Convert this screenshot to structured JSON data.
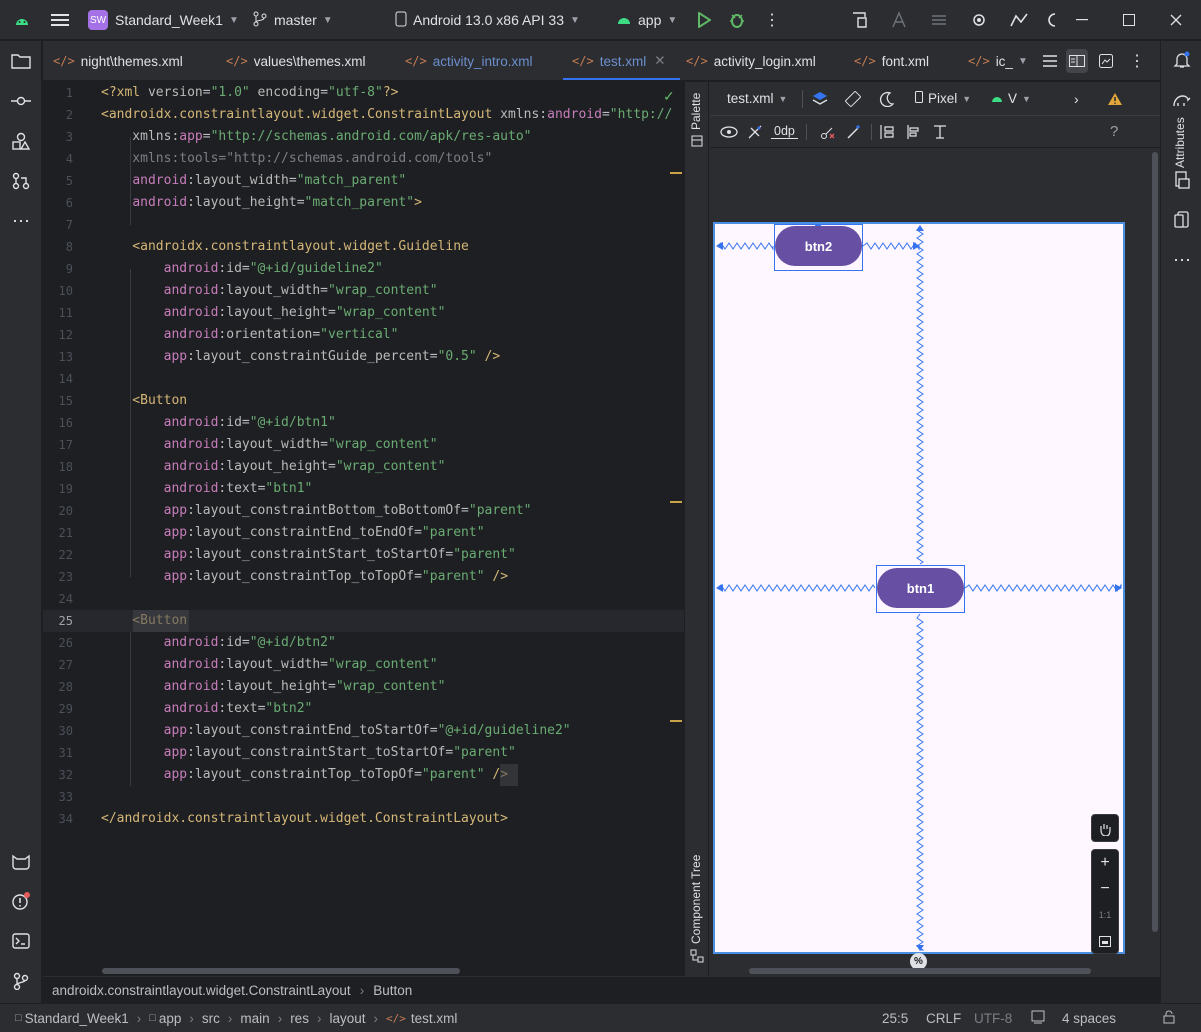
{
  "titlebar": {
    "project_badge": "SW",
    "project": "Standard_Week1",
    "branch": "master",
    "device": "Android 13.0 x86 API 33",
    "run_config": "app"
  },
  "tabs": [
    {
      "label": "night\\themes.xml",
      "active": false
    },
    {
      "label": "values\\themes.xml",
      "active": false
    },
    {
      "label": "activity_intro.xml",
      "active": false
    },
    {
      "label": "test.xml",
      "active": true
    },
    {
      "label": "activity_login.xml",
      "active": false
    },
    {
      "label": "font.xml",
      "active": false
    },
    {
      "label": "ic_",
      "active": false
    }
  ],
  "editor": {
    "line_numbers": [
      "1",
      "2",
      "3",
      "4",
      "5",
      "6",
      "7",
      "8",
      "9",
      "10",
      "11",
      "12",
      "13",
      "14",
      "15",
      "16",
      "17",
      "18",
      "19",
      "20",
      "21",
      "22",
      "23",
      "24",
      "25",
      "26",
      "27",
      "28",
      "29",
      "30",
      "31",
      "32",
      "33",
      "34"
    ],
    "current_line": "25",
    "lines": [
      [
        [
          "<?xml ",
          "t-tag"
        ],
        [
          "version",
          "t-attr"
        ],
        [
          "=",
          "t-pl"
        ],
        [
          "\"1.0\"",
          "t-str"
        ],
        [
          " encoding",
          "t-attr"
        ],
        [
          "=",
          "t-pl"
        ],
        [
          "\"utf-8\"",
          "t-str"
        ],
        [
          "?>",
          "t-tag"
        ]
      ],
      [
        [
          "<androidx.constraintlayout.widget.ConstraintLayout ",
          "t-tag"
        ],
        [
          "xmlns:",
          "t-attr"
        ],
        [
          "android",
          "t-ns"
        ],
        [
          "=",
          "t-pl"
        ],
        [
          "\"http://",
          "t-str"
        ]
      ],
      [
        [
          "    xmlns:",
          "t-attr"
        ],
        [
          "app",
          "t-ns"
        ],
        [
          "=",
          "t-pl"
        ],
        [
          "\"http://schemas.android.com/apk/res-auto\"",
          "t-str"
        ]
      ],
      [
        [
          "    xmlns:tools=\"http://schemas.android.com/tools\"",
          "t-dim"
        ]
      ],
      [
        [
          "    ",
          "t-pl"
        ],
        [
          "android",
          "t-ns"
        ],
        [
          ":layout_width",
          "t-attr"
        ],
        [
          "=",
          "t-pl"
        ],
        [
          "\"match_parent\"",
          "t-str"
        ]
      ],
      [
        [
          "    ",
          "t-pl"
        ],
        [
          "android",
          "t-ns"
        ],
        [
          ":layout_height",
          "t-attr"
        ],
        [
          "=",
          "t-pl"
        ],
        [
          "\"match_parent\"",
          "t-str"
        ],
        [
          ">",
          "t-tag"
        ]
      ],
      [
        [
          "",
          "t-pl"
        ]
      ],
      [
        [
          "    <androidx.constraintlayout.widget.Guideline",
          "t-tag"
        ]
      ],
      [
        [
          "        ",
          "t-pl"
        ],
        [
          "android",
          "t-ns"
        ],
        [
          ":id",
          "t-attr"
        ],
        [
          "=",
          "t-pl"
        ],
        [
          "\"@+id/guideline2\"",
          "t-str"
        ]
      ],
      [
        [
          "        ",
          "t-pl"
        ],
        [
          "android",
          "t-ns"
        ],
        [
          ":layout_width",
          "t-attr"
        ],
        [
          "=",
          "t-pl"
        ],
        [
          "\"wrap_content\"",
          "t-str"
        ]
      ],
      [
        [
          "        ",
          "t-pl"
        ],
        [
          "android",
          "t-ns"
        ],
        [
          ":layout_height",
          "t-attr"
        ],
        [
          "=",
          "t-pl"
        ],
        [
          "\"wrap_content\"",
          "t-str"
        ]
      ],
      [
        [
          "        ",
          "t-pl"
        ],
        [
          "android",
          "t-ns"
        ],
        [
          ":orientation",
          "t-attr"
        ],
        [
          "=",
          "t-pl"
        ],
        [
          "\"vertical\"",
          "t-str"
        ]
      ],
      [
        [
          "        ",
          "t-pl"
        ],
        [
          "app",
          "t-ns"
        ],
        [
          ":layout_constraintGuide_percent",
          "t-attr"
        ],
        [
          "=",
          "t-pl"
        ],
        [
          "\"0.5\"",
          "t-str"
        ],
        [
          " />",
          "t-tag"
        ]
      ],
      [
        [
          "",
          "t-pl"
        ]
      ],
      [
        [
          "    <Button",
          "t-tag"
        ]
      ],
      [
        [
          "        ",
          "t-pl"
        ],
        [
          "android",
          "t-ns"
        ],
        [
          ":id",
          "t-attr"
        ],
        [
          "=",
          "t-pl"
        ],
        [
          "\"@+id/btn1\"",
          "t-str"
        ]
      ],
      [
        [
          "        ",
          "t-pl"
        ],
        [
          "android",
          "t-ns"
        ],
        [
          ":layout_width",
          "t-attr"
        ],
        [
          "=",
          "t-pl"
        ],
        [
          "\"wrap_content\"",
          "t-str"
        ]
      ],
      [
        [
          "        ",
          "t-pl"
        ],
        [
          "android",
          "t-ns"
        ],
        [
          ":layout_height",
          "t-attr"
        ],
        [
          "=",
          "t-pl"
        ],
        [
          "\"wrap_content\"",
          "t-str"
        ]
      ],
      [
        [
          "        ",
          "t-pl"
        ],
        [
          "android",
          "t-ns"
        ],
        [
          ":text",
          "t-attr"
        ],
        [
          "=",
          "t-pl"
        ],
        [
          "\"btn1\"",
          "t-str"
        ]
      ],
      [
        [
          "        ",
          "t-pl"
        ],
        [
          "app",
          "t-ns"
        ],
        [
          ":layout_constraintBottom_toBottomOf",
          "t-attr"
        ],
        [
          "=",
          "t-pl"
        ],
        [
          "\"parent\"",
          "t-str"
        ]
      ],
      [
        [
          "        ",
          "t-pl"
        ],
        [
          "app",
          "t-ns"
        ],
        [
          ":layout_constraintEnd_toEndOf",
          "t-attr"
        ],
        [
          "=",
          "t-pl"
        ],
        [
          "\"parent\"",
          "t-str"
        ]
      ],
      [
        [
          "        ",
          "t-pl"
        ],
        [
          "app",
          "t-ns"
        ],
        [
          ":layout_constraintStart_toStartOf",
          "t-attr"
        ],
        [
          "=",
          "t-pl"
        ],
        [
          "\"parent\"",
          "t-str"
        ]
      ],
      [
        [
          "        ",
          "t-pl"
        ],
        [
          "app",
          "t-ns"
        ],
        [
          ":layout_constraintTop_toTopOf",
          "t-attr"
        ],
        [
          "=",
          "t-pl"
        ],
        [
          "\"parent\"",
          "t-str"
        ],
        [
          " />",
          "t-tag"
        ]
      ],
      [
        [
          "",
          "t-pl"
        ]
      ],
      [
        [
          "    <Button",
          "t-tag"
        ]
      ],
      [
        [
          "        ",
          "t-pl"
        ],
        [
          "android",
          "t-ns"
        ],
        [
          ":id",
          "t-attr"
        ],
        [
          "=",
          "t-pl"
        ],
        [
          "\"@+id/btn2\"",
          "t-str"
        ]
      ],
      [
        [
          "        ",
          "t-pl"
        ],
        [
          "android",
          "t-ns"
        ],
        [
          ":layout_width",
          "t-attr"
        ],
        [
          "=",
          "t-pl"
        ],
        [
          "\"wrap_content\"",
          "t-str"
        ]
      ],
      [
        [
          "        ",
          "t-pl"
        ],
        [
          "android",
          "t-ns"
        ],
        [
          ":layout_height",
          "t-attr"
        ],
        [
          "=",
          "t-pl"
        ],
        [
          "\"wrap_content\"",
          "t-str"
        ]
      ],
      [
        [
          "        ",
          "t-pl"
        ],
        [
          "android",
          "t-ns"
        ],
        [
          ":text",
          "t-attr"
        ],
        [
          "=",
          "t-pl"
        ],
        [
          "\"btn2\"",
          "t-str"
        ]
      ],
      [
        [
          "        ",
          "t-pl"
        ],
        [
          "app",
          "t-ns"
        ],
        [
          ":layout_constraintEnd_toStartOf",
          "t-attr"
        ],
        [
          "=",
          "t-pl"
        ],
        [
          "\"@+id/guideline2\"",
          "t-str"
        ]
      ],
      [
        [
          "        ",
          "t-pl"
        ],
        [
          "app",
          "t-ns"
        ],
        [
          ":layout_constraintStart_toStartOf",
          "t-attr"
        ],
        [
          "=",
          "t-pl"
        ],
        [
          "\"parent\"",
          "t-str"
        ]
      ],
      [
        [
          "        ",
          "t-pl"
        ],
        [
          "app",
          "t-ns"
        ],
        [
          ":layout_constraintTop_toTopOf",
          "t-attr"
        ],
        [
          "=",
          "t-pl"
        ],
        [
          "\"parent\"",
          "t-str"
        ],
        [
          " />",
          "t-tag"
        ]
      ],
      [
        [
          "",
          "t-pl"
        ]
      ],
      [
        [
          "</androidx.constraintlayout.widget.ConstraintLayout>",
          "t-tag"
        ]
      ]
    ]
  },
  "designer": {
    "file_dropdown": "test.xml",
    "device_dropdown": "Pixel",
    "api_dropdown": "V",
    "margin": "0dp",
    "palette_label": "Palette",
    "component_tree_label": "Component Tree",
    "attributes_label": "Attributes",
    "btn1_label": "btn1",
    "btn2_label": "btn2",
    "zoom_one_to_one": "1:1",
    "guideline_marker": "%"
  },
  "breadcrumb": {
    "items": [
      "androidx.constraintlayout.widget.ConstraintLayout",
      "Button"
    ]
  },
  "statusbar": {
    "path": [
      "Standard_Week1",
      "app",
      "src",
      "main",
      "res",
      "layout",
      "test.xml"
    ],
    "position": "25:5",
    "line_ending": "CRLF",
    "encoding": "UTF-8",
    "indent": "4 spaces"
  },
  "colors": {
    "accent": "#6750a4",
    "selection": "#3573f0",
    "tag": "#d5b778",
    "string": "#6aab73",
    "namespace": "#c77dbb"
  }
}
